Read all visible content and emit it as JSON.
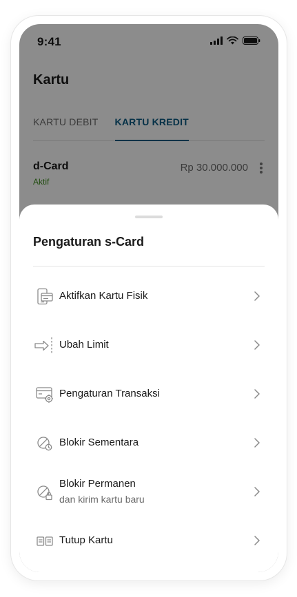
{
  "status_bar": {
    "time": "9:41"
  },
  "page": {
    "title": "Kartu",
    "tabs": [
      {
        "label": "KARTU DEBIT",
        "active": false
      },
      {
        "label": "KARTU KREDIT",
        "active": true
      }
    ],
    "card": {
      "name": "d-Card",
      "status": "Aktif",
      "amount": "Rp 30.000.000"
    }
  },
  "sheet": {
    "title": "Pengaturan s-Card",
    "items": [
      {
        "label": "Aktifkan Kartu Fisik",
        "icon": "physical-card-icon"
      },
      {
        "label": "Ubah Limit",
        "icon": "change-limit-icon"
      },
      {
        "label": "Pengaturan Transaksi",
        "icon": "transaction-settings-icon"
      },
      {
        "label": "Blokir Sementara",
        "icon": "temporary-block-icon"
      },
      {
        "label": "Blokir Permanen",
        "sublabel": "dan kirim kartu baru",
        "icon": "permanent-block-icon"
      },
      {
        "label": "Tutup Kartu",
        "icon": "close-card-icon"
      }
    ]
  },
  "colors": {
    "accent": "#0a5a82",
    "active_status": "#3f8d1f",
    "overlay": "rgba(0,0,0,0.45)"
  }
}
